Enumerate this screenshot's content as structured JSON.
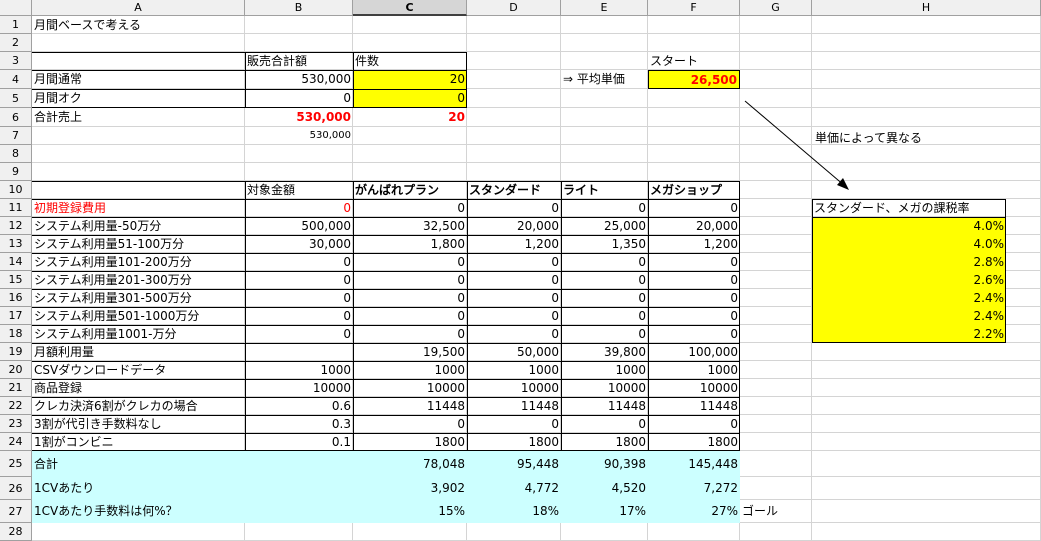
{
  "columns": [
    "A",
    "B",
    "C",
    "D",
    "E",
    "F",
    "G",
    "H"
  ],
  "selected_column": "C",
  "rows": [
    "1",
    "2",
    "3",
    "4",
    "5",
    "6",
    "7",
    "8",
    "9",
    "10",
    "11",
    "12",
    "13",
    "14",
    "15",
    "16",
    "17",
    "18",
    "19",
    "20",
    "21",
    "22",
    "23",
    "24",
    "25",
    "26",
    "27",
    "28"
  ],
  "title": "月間ベースで考える",
  "block1": {
    "hdr_b": "販売合計額",
    "hdr_c": "件数",
    "r4_a": "月間通常",
    "r4_b": "530,000",
    "r4_c": "20",
    "r5_a": "月間オク",
    "r5_b": "0",
    "r5_c": "0",
    "r6_a": "合計売上",
    "r6_b": "530,000",
    "r6_c": "20",
    "r7_b": "530,000"
  },
  "avg": {
    "arrow_label": "⇒ 平均単価",
    "start_label": "スタート",
    "value": "26,500"
  },
  "note": "単価によって異なる",
  "tax_box": {
    "title": "スタンダード、メガの課税率",
    "values": [
      "4.0%",
      "4.0%",
      "2.8%",
      "2.6%",
      "2.4%",
      "2.4%",
      "2.2%"
    ]
  },
  "table": {
    "headers": [
      "対象金額",
      "がんばれプラン",
      "スタンダード",
      "ライト",
      "メガショップ"
    ],
    "rows": [
      {
        "label": "初期登録費用",
        "b": "0",
        "c": "0",
        "d": "0",
        "e": "0",
        "f": "0"
      },
      {
        "label": "システム利用量-50万分",
        "b": "500,000",
        "c": "32,500",
        "d": "20,000",
        "e": "25,000",
        "f": "20,000"
      },
      {
        "label": "システム利用量51-100万分",
        "b": "30,000",
        "c": "1,800",
        "d": "1,200",
        "e": "1,350",
        "f": "1,200"
      },
      {
        "label": "システム利用量101-200万分",
        "b": "0",
        "c": "0",
        "d": "0",
        "e": "0",
        "f": "0"
      },
      {
        "label": "システム利用量201-300万分",
        "b": "0",
        "c": "0",
        "d": "0",
        "e": "0",
        "f": "0"
      },
      {
        "label": "システム利用量301-500万分",
        "b": "0",
        "c": "0",
        "d": "0",
        "e": "0",
        "f": "0"
      },
      {
        "label": "システム利用量501-1000万分",
        "b": "0",
        "c": "0",
        "d": "0",
        "e": "0",
        "f": "0"
      },
      {
        "label": "システム利用量1001-万分",
        "b": "0",
        "c": "0",
        "d": "0",
        "e": "0",
        "f": "0"
      },
      {
        "label": "月額利用量",
        "b": "",
        "c": "19,500",
        "d": "50,000",
        "e": "39,800",
        "f": "100,000"
      },
      {
        "label": "CSVダウンロードデータ",
        "b": "1000",
        "c": "1000",
        "d": "1000",
        "e": "1000",
        "f": "1000"
      },
      {
        "label": "商品登録",
        "b": "10000",
        "c": "10000",
        "d": "10000",
        "e": "10000",
        "f": "10000"
      },
      {
        "label": "クレカ決済6割がクレカの場合",
        "b": "0.6",
        "c": "11448",
        "d": "11448",
        "e": "11448",
        "f": "11448"
      },
      {
        "label": "3割が代引き手数料なし",
        "b": "0.3",
        "c": "0",
        "d": "0",
        "e": "0",
        "f": "0"
      },
      {
        "label": "1割がコンビニ",
        "b": "0.1",
        "c": "1800",
        "d": "1800",
        "e": "1800",
        "f": "1800"
      }
    ],
    "summary": [
      {
        "label": "合計",
        "c": "78,048",
        "d": "95,448",
        "e": "90,398",
        "f": "145,448"
      },
      {
        "label": "1CVあたり",
        "c": "3,902",
        "d": "4,772",
        "e": "4,520",
        "f": "7,272"
      },
      {
        "label": "1CVあたり手数料は何%？",
        "c": "15%",
        "d": "18%",
        "e": "17%",
        "f": "27%"
      }
    ],
    "goal": "ゴール"
  }
}
